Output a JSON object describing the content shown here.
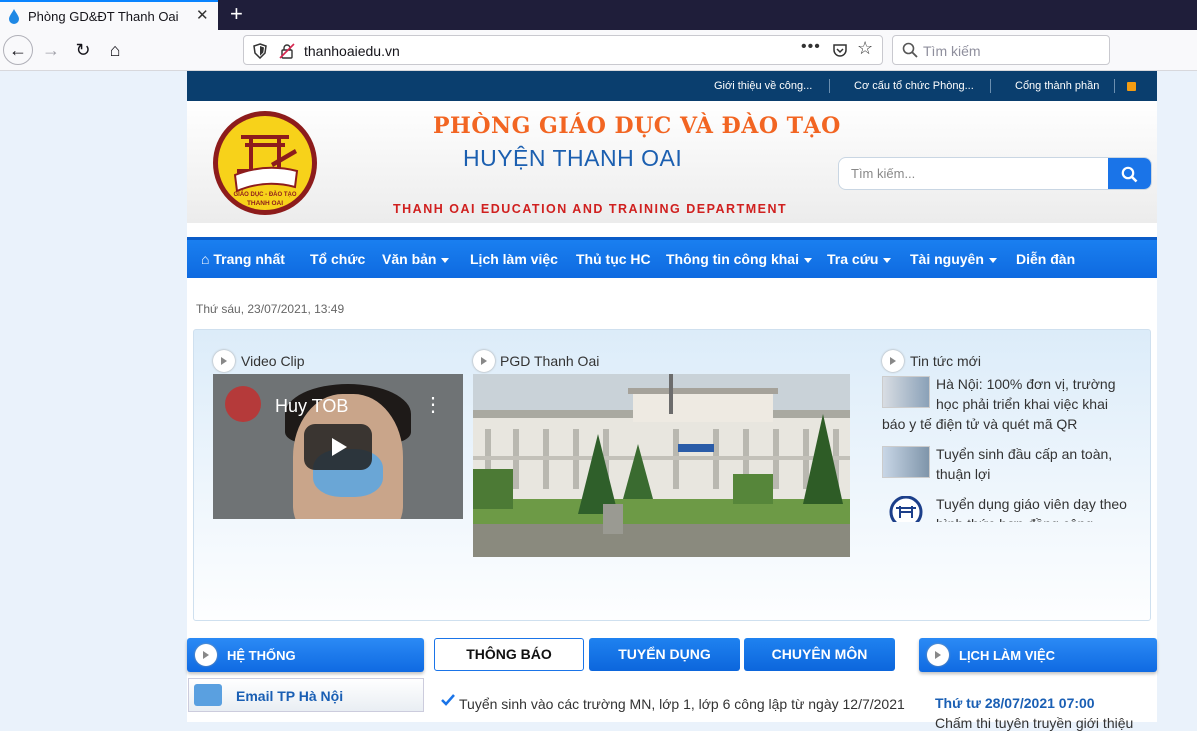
{
  "browser": {
    "tab_title": "Phòng GD&ĐT Thanh Oai",
    "url": "thanhoaiedu.vn",
    "search_placeholder": "Tìm kiếm"
  },
  "topbar": {
    "links": [
      "Giới thiệu về công...",
      "Cơ cấu tổ chức Phòng...",
      "Cổng thành phần"
    ]
  },
  "banner": {
    "logo_text_top": "GIÁO DỤC - ĐÀO TẠO",
    "logo_text_bottom": "THANH OAI",
    "title_line1": "PHÒNG GIÁO DỤC VÀ ĐÀO TẠO",
    "title_line2": "HUYỆN THANH OAI",
    "title_line3": "THANH OAI EDUCATION AND TRAINING DEPARTMENT",
    "search_placeholder": "Tìm kiếm..."
  },
  "nav": {
    "items": [
      {
        "label": "Trang nhất"
      },
      {
        "label": "Tổ chức"
      },
      {
        "label": "Văn bản"
      },
      {
        "label": "Lịch làm việc"
      },
      {
        "label": "Thủ tục HC"
      },
      {
        "label": "Thông tin công khai"
      },
      {
        "label": "Tra cứu"
      },
      {
        "label": "Tài nguyên"
      },
      {
        "label": "Diễn đàn"
      }
    ]
  },
  "datetime": "Thứ sáu, 23/07/2021, 13:49",
  "featured": {
    "video_heading": "Video Clip",
    "video_title": "Huy TOB",
    "photo_heading": "PGD Thanh Oai",
    "news_heading": "Tin tức mới",
    "news": [
      "Hà Nội: 100% đơn vị, trường học phải triển khai việc khai báo y tế điện tử và quét mã QR",
      "Tuyển sinh đầu cấp an toàn, thuận lợi",
      "Tuyển dụng giáo viên dạy theo hình thức hợp đồng công"
    ]
  },
  "bottom": {
    "left_heading": "HỆ THỐNG",
    "email_label": "Email TP Hà Nội",
    "tabs": [
      "THÔNG BÁO",
      "TUYỂN DỤNG",
      "CHUYÊN MÔN"
    ],
    "notice": "Tuyển sinh vào các trường MN, lớp 1, lớp 6 công lập từ ngày 12/7/2021",
    "right_heading": "LỊCH LÀM VIỆC",
    "schedule_date": "Thứ tư 28/07/2021 07:00",
    "schedule_next": "Chấm thi tuyên truyền giới thiệu"
  },
  "colors": {
    "topbar": "#0a3e6e",
    "nav_blue": "#1a7ff0",
    "title_orange": "#f26522",
    "title_blue": "#1b5fb0",
    "title_red": "#d0201f"
  }
}
